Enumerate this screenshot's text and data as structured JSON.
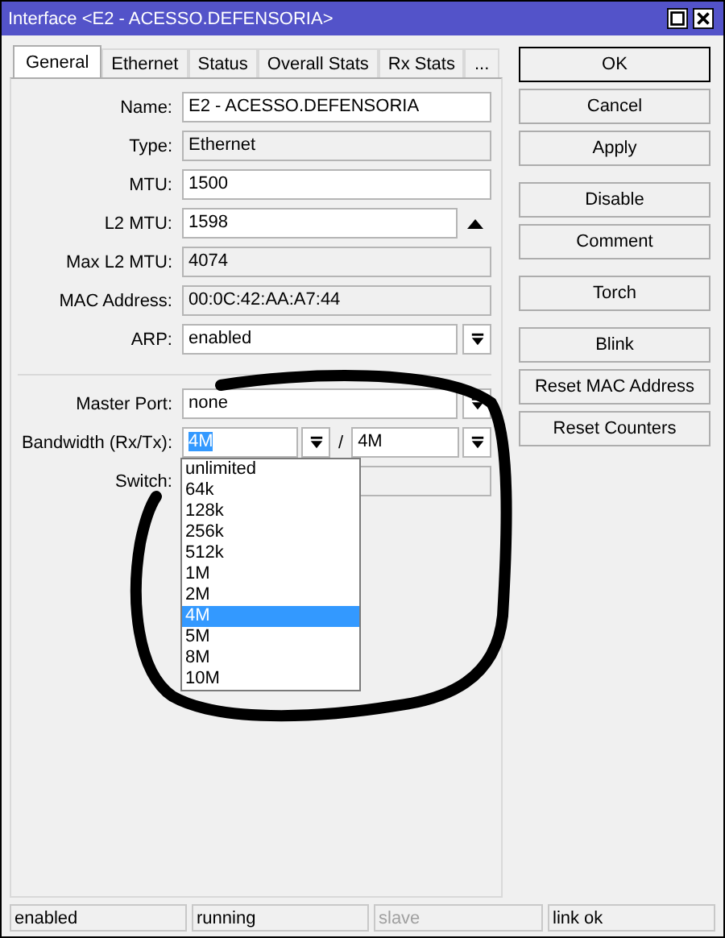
{
  "window": {
    "title": "Interface <E2 - ACESSO.DEFENSORIA>"
  },
  "tabs": [
    {
      "label": "General",
      "selected": true
    },
    {
      "label": "Ethernet",
      "selected": false
    },
    {
      "label": "Status",
      "selected": false
    },
    {
      "label": "Overall Stats",
      "selected": false
    },
    {
      "label": "Rx Stats",
      "selected": false
    },
    {
      "label": "...",
      "selected": false
    }
  ],
  "general_fields": [
    {
      "label": "Name:",
      "value": "E2 - ACESSO.DEFENSORIA",
      "kind": "text"
    },
    {
      "label": "Type:",
      "value": "Ethernet",
      "kind": "readonly"
    },
    {
      "label": "MTU:",
      "value": "1500",
      "kind": "text"
    },
    {
      "label": "L2 MTU:",
      "value": "1598",
      "kind": "spinner"
    },
    {
      "label": "Max L2 MTU:",
      "value": "4074",
      "kind": "readonly"
    },
    {
      "label": "MAC Address:",
      "value": "00:0C:42:AA:A7:44",
      "kind": "readonly"
    },
    {
      "label": "ARP:",
      "value": "enabled",
      "kind": "dropdown"
    }
  ],
  "master_port": {
    "label": "Master Port:",
    "value": "none"
  },
  "bandwidth": {
    "label": "Bandwidth (Rx/Tx):",
    "rx": "4M",
    "rx_text_selected": true,
    "separator": "/",
    "tx": "4M"
  },
  "switch": {
    "label": "Switch:"
  },
  "dropdown_options": [
    {
      "label": "unlimited",
      "selected": false
    },
    {
      "label": "64k",
      "selected": false
    },
    {
      "label": "128k",
      "selected": false
    },
    {
      "label": "256k",
      "selected": false
    },
    {
      "label": "512k",
      "selected": false
    },
    {
      "label": "1M",
      "selected": false
    },
    {
      "label": "2M",
      "selected": false
    },
    {
      "label": "4M",
      "selected": true
    },
    {
      "label": "5M",
      "selected": false
    },
    {
      "label": "8M",
      "selected": false
    },
    {
      "label": "10M",
      "selected": false
    }
  ],
  "button_groups": [
    [
      {
        "label": "OK",
        "default": true
      },
      {
        "label": "Cancel",
        "default": false
      },
      {
        "label": "Apply",
        "default": false
      }
    ],
    [
      {
        "label": "Disable",
        "default": false
      },
      {
        "label": "Comment",
        "default": false
      }
    ],
    [
      {
        "label": "Torch",
        "default": false
      }
    ],
    [
      {
        "label": "Blink",
        "default": false
      },
      {
        "label": "Reset MAC Address",
        "default": false
      },
      {
        "label": "Reset Counters",
        "default": false
      }
    ]
  ],
  "status_bar": [
    {
      "text": "enabled",
      "disabled": false
    },
    {
      "text": "running",
      "disabled": false
    },
    {
      "text": "slave",
      "disabled": true
    },
    {
      "text": "link ok",
      "disabled": false
    }
  ]
}
